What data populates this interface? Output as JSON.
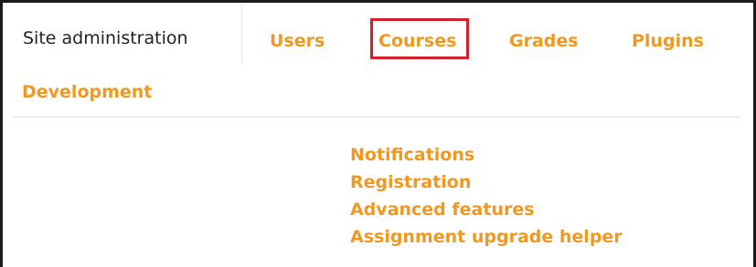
{
  "tabs": {
    "current": "Site administration",
    "users": "Users",
    "courses": "Courses",
    "grades": "Grades",
    "plugins": "Plugins",
    "development": "Development"
  },
  "highlight": {
    "target": "Courses",
    "color": "#d0202a"
  },
  "submenu": {
    "items": [
      "Notifications",
      "Registration",
      "Advanced features",
      "Assignment upgrade helper"
    ]
  },
  "colors": {
    "link": "#f0981f",
    "text": "#222222",
    "divider": "#e4e4e4"
  }
}
